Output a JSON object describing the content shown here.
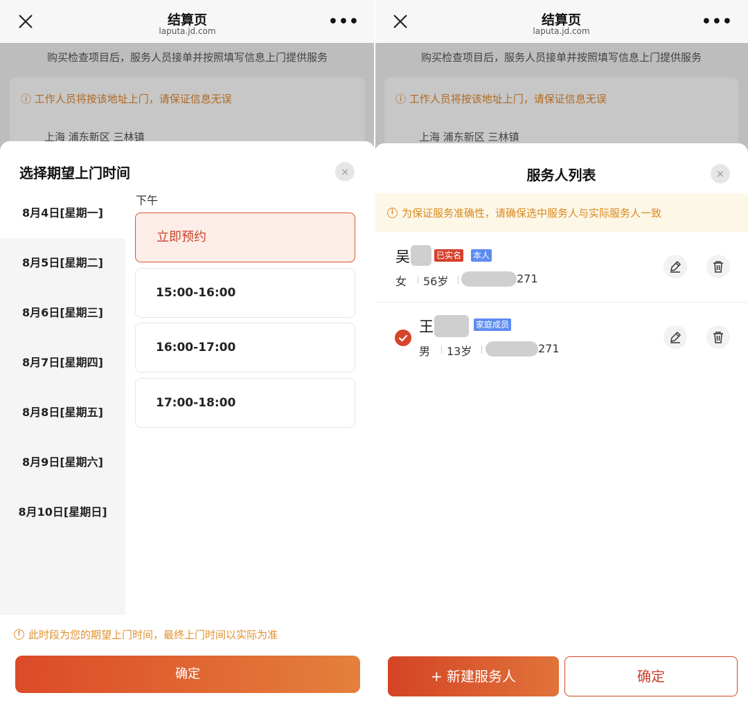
{
  "nav": {
    "title": "结算页",
    "subtitle": "laputa.jd.com",
    "more": "•••"
  },
  "background": {
    "notice": "购买检查项目后，服务人员接单并按照填写信息上门提供服务",
    "warning": "工作人员将按该地址上门，请保证信息无误",
    "address": "上海 浦东新区 三林镇"
  },
  "time_sheet": {
    "title": "选择期望上门时间",
    "close": "×",
    "dates": [
      "8月4日[星期一]",
      "8月5日[星期二]",
      "8月6日[星期三]",
      "8月7日[星期四]",
      "8月8日[星期五]",
      "8月9日[星期六]",
      "8月10日[星期日]"
    ],
    "selected_date": "8月4日[星期一]",
    "period": "下午",
    "slots": [
      "立即预约",
      "15:00-16:00",
      "16:00-17:00",
      "17:00-18:00"
    ],
    "selected_slot": "立即预约",
    "tip": "此时段为您的期望上门时间，最终上门时间以实际为准",
    "confirm": "确定",
    "info_glyph": "!"
  },
  "person_sheet": {
    "title": "服务人列表",
    "close": "×",
    "warning": "为保证服务准确性，请确保选中服务人与实际服务人一致",
    "info_glyph": "i",
    "persons": [
      {
        "surname": "吴",
        "tags": [
          "已实名",
          "本人"
        ],
        "gender": "女",
        "age": "56岁",
        "phone_tail": "271",
        "selected": false
      },
      {
        "surname": "王",
        "tags": [
          "家庭成员"
        ],
        "gender": "男",
        "age": "13岁",
        "phone_tail": "271",
        "selected": true
      }
    ],
    "new_button": "+ 新建服务人",
    "confirm": "确定"
  },
  "colors": {
    "accent": "#d5442c",
    "warning": "#e0902e",
    "tag_blue": "#5d8cf0"
  },
  "icons": [
    "close-icon",
    "more-icon",
    "info-icon",
    "edit-icon",
    "trash-icon",
    "check-icon"
  ]
}
